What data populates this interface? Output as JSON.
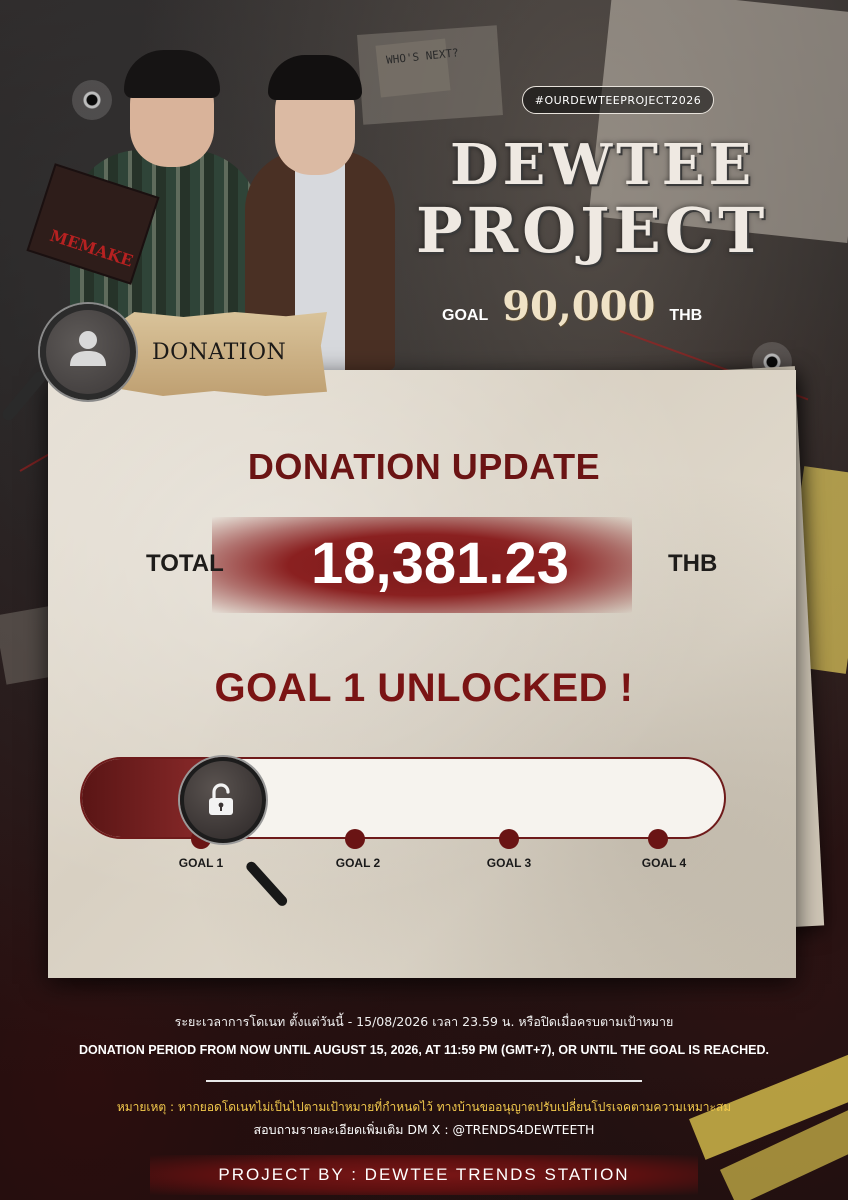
{
  "header": {
    "hashtag": "#OURDEWTEEPROJECT2026",
    "title_line1": "DEWTEE",
    "title_line2": "PROJECT",
    "goal_word": "GOAL",
    "goal_amount": "90,000",
    "goal_unit": "THB",
    "sticky_note": "WHO'S NEXT?",
    "book_title": "MEMAKE"
  },
  "tag": {
    "label": "DONATION",
    "icon": "user-icon"
  },
  "panel": {
    "title": "DONATION UPDATE",
    "total_label": "TOTAL",
    "total_value": "18,381.23",
    "total_unit": "THB",
    "status": "GOAL 1 UNLOCKED !"
  },
  "progress": {
    "fraction": 0.204,
    "icon": "unlocked-padlock-icon",
    "goals": [
      "GOAL 1",
      "GOAL 2",
      "GOAL 3",
      "GOAL 4"
    ]
  },
  "footer": {
    "thai_period": "ระยะเวลาการโดเนท ตั้งแต่วันนี้ - 15/08/2026 เวลา 23.59 น. หรือปิดเมื่อครบตามเป้าหมาย",
    "en_period": "DONATION PERIOD FROM NOW UNTIL AUGUST 15, 2026, AT 11:59 PM (GMT+7), OR UNTIL THE GOAL IS REACHED.",
    "note": "หมายเหตุ : หากยอดโดเนทไม่เป็นไปตามเป้าหมายที่กำหนดไว้ ทางบ้านขออนุญาตปรับเปลี่ยนโปรเจคตามความเหมาะสม",
    "contact": "สอบถามรายละเอียดเพิ่มเติม DM X : @TRENDS4DEWTEETH",
    "credit": "PROJECT BY : DEWTEE TRENDS STATION"
  },
  "colors": {
    "accent_red": "#6b1414",
    "note_yellow": "#f2c94c",
    "paper": "#e0d9cc"
  }
}
